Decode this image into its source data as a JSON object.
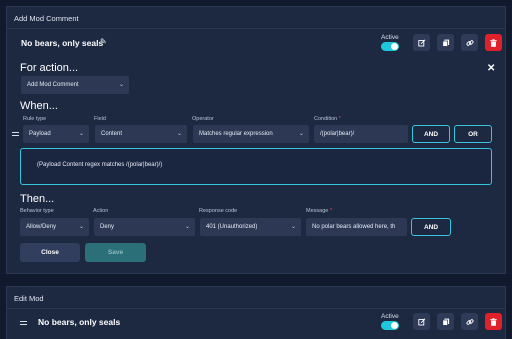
{
  "panel1": {
    "header": "Add Mod Comment",
    "rule_name": "No bears, only seals",
    "pencil_glyph": "✎",
    "active_label": "Active",
    "active": true,
    "icons": {
      "edit": "edit-icon",
      "copy": "copy-icon",
      "link": "link-icon",
      "delete": "trash-icon"
    }
  },
  "for_action": {
    "title": "For action...",
    "value": "Add Mod Comment",
    "close_glyph": "✕"
  },
  "when": {
    "title": "When...",
    "labels": {
      "rule_type": "Rule type",
      "field": "Field",
      "operator": "Operator",
      "condition": "Condition"
    },
    "rule_type": "Payload",
    "field": "Content",
    "operator": "Matches regular expression",
    "condition": "/(polar|bear)/",
    "and_label": "AND",
    "or_label": "OR",
    "preview": "(Payload Content regex matches /(polar|bear)/)"
  },
  "then": {
    "title": "Then...",
    "labels": {
      "behavior_type": "Behavior type",
      "action": "Action",
      "response_code": "Response code",
      "message": "Message"
    },
    "behavior_type": "Allow/Deny",
    "action": "Deny",
    "response_code": "401 (Unauthorized)",
    "message": "No polar bears allowed here, th",
    "and_label": "AND"
  },
  "buttons": {
    "close": "Close",
    "save": "Save"
  },
  "panel2": {
    "header": "Edit Mod",
    "rule_name": "No bears, only seals",
    "active_label": "Active",
    "active": true
  },
  "colors": {
    "accent": "#37c6df",
    "toggle": "#1ec8dc",
    "danger": "#e0202a",
    "panel": "#1d2841",
    "background": "#111a2c"
  }
}
